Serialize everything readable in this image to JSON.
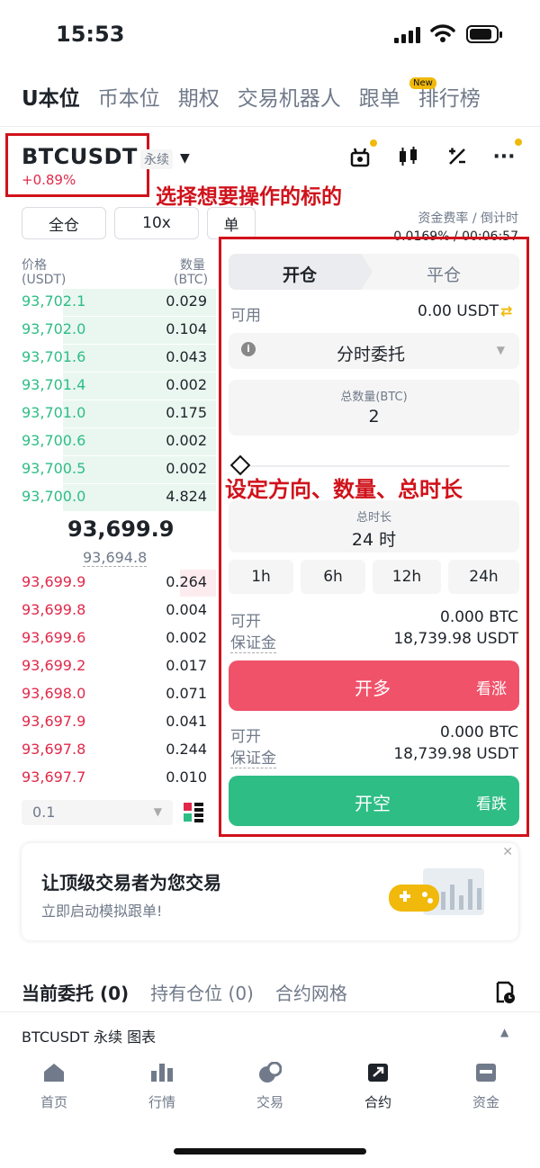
{
  "status": {
    "time": "15:53"
  },
  "top_nav": [
    "U本位",
    "币本位",
    "期权",
    "交易机器人",
    "跟单",
    "排行榜"
  ],
  "top_nav_badge": "New",
  "symbol": {
    "name": "BTCUSDT",
    "type": "永续",
    "change": "+0.89%"
  },
  "annotations": {
    "select": "选择想要操作的标的",
    "set": "设定方向、数量、总时长"
  },
  "chips": {
    "margin_mode": "全仓",
    "leverage": "10x",
    "position_mode": "单"
  },
  "funding": {
    "label": "资金费率 / 倒计时",
    "value": "0.0169% / 00:06:57"
  },
  "order_book": {
    "price_header": "价格",
    "price_unit": "(USDT)",
    "qty_header": "数量",
    "qty_unit": "(BTC)",
    "asks": [
      {
        "price": "93,702.1",
        "qty": "0.029",
        "depth": 0.6
      },
      {
        "price": "93,702.0",
        "qty": "0.104",
        "depth": 0.7
      },
      {
        "price": "93,701.6",
        "qty": "0.043",
        "depth": 0.65
      },
      {
        "price": "93,701.4",
        "qty": "0.002",
        "depth": 0.55
      },
      {
        "price": "93,701.0",
        "qty": "0.175",
        "depth": 0.75
      },
      {
        "price": "93,700.6",
        "qty": "0.002",
        "depth": 0.6
      },
      {
        "price": "93,700.5",
        "qty": "0.002",
        "depth": 0.55
      },
      {
        "price": "93,700.0",
        "qty": "4.824",
        "depth": 0.9
      }
    ],
    "last_price": "93,699.9",
    "mark_price": "93,694.8",
    "bids": [
      {
        "price": "93,699.9",
        "qty": "0.264"
      },
      {
        "price": "93,699.8",
        "qty": "0.004"
      },
      {
        "price": "93,699.6",
        "qty": "0.002"
      },
      {
        "price": "93,699.2",
        "qty": "0.017"
      },
      {
        "price": "93,698.0",
        "qty": "0.071"
      },
      {
        "price": "93,697.9",
        "qty": "0.041"
      },
      {
        "price": "93,697.8",
        "qty": "0.244"
      },
      {
        "price": "93,697.7",
        "qty": "0.010"
      }
    ],
    "precision": "0.1"
  },
  "trade": {
    "tab_open": "开仓",
    "tab_close": "平仓",
    "available_label": "可用",
    "available_value": "0.00 USDT",
    "order_type": "分时委托",
    "total_qty_label": "总数量(BTC)",
    "total_qty_value": "2",
    "duration_label": "总时长",
    "duration_value": "24 时",
    "duration_options": [
      "1h",
      "6h",
      "12h",
      "24h"
    ],
    "long": {
      "can_open_label": "可开",
      "can_open_value": "0.000 BTC",
      "margin_label": "保证金",
      "margin_value": "18,739.98 USDT",
      "button": "开多",
      "button_sub": "看涨"
    },
    "short": {
      "can_open_label": "可开",
      "can_open_value": "0.000 BTC",
      "margin_label": "保证金",
      "margin_value": "18,739.98 USDT",
      "button": "开空",
      "button_sub": "看跌"
    }
  },
  "promo": {
    "title": "让顶级交易者为您交易",
    "subtitle": "立即启动模拟跟单!"
  },
  "order_tabs": [
    "当前委托 (0)",
    "持有仓位 (0)",
    "合约网格"
  ],
  "chart_bar": {
    "label": "BTCUSDT 永续  图表"
  },
  "bottom_nav": [
    "首页",
    "行情",
    "交易",
    "合约",
    "资金"
  ],
  "colors": {
    "green": "#2ebd85",
    "red": "#e0294a",
    "accent": "#f0b90b",
    "annotation": "#d0121b"
  }
}
